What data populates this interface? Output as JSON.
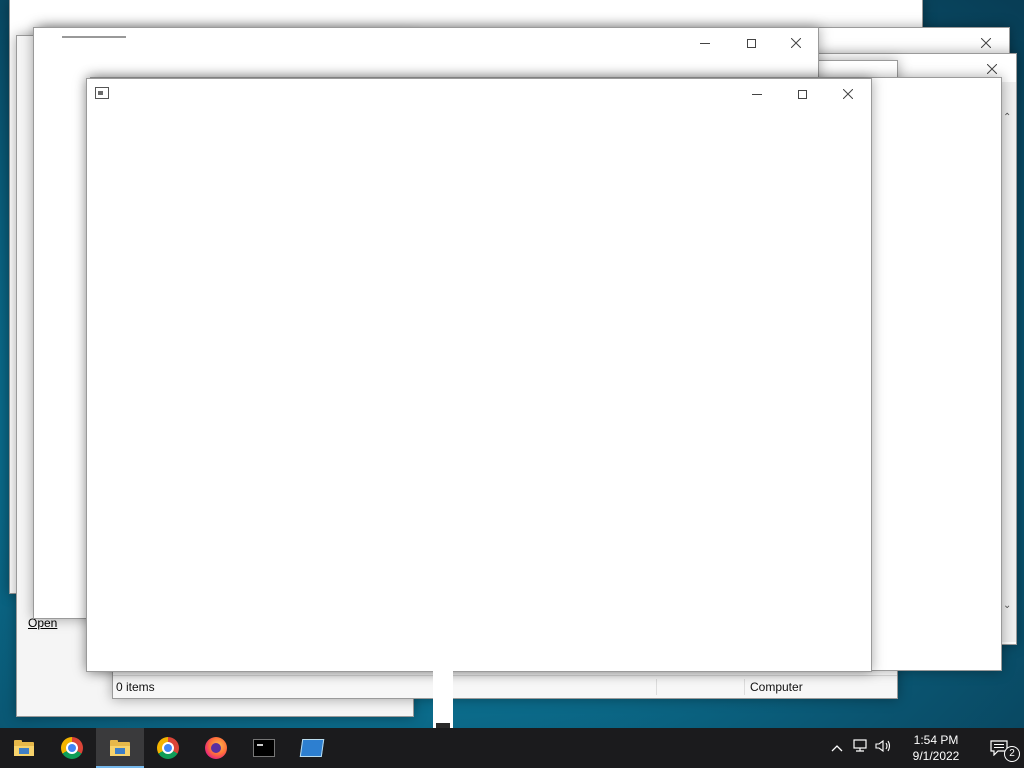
{
  "windows": {
    "back_window_status_left": "0 items",
    "back_window_status_right": "Computer",
    "open_label": "Open"
  },
  "taskbar": {
    "apps": [
      {
        "name": "File Explorer"
      },
      {
        "name": "Google Chrome"
      },
      {
        "name": "File Explorer (active)"
      },
      {
        "name": "Google Chrome"
      },
      {
        "name": "Firefox"
      },
      {
        "name": "Command Prompt"
      },
      {
        "name": "Remote Desktop"
      }
    ],
    "time": "1:54 PM",
    "date": "9/1/2022",
    "notification_count": "2"
  },
  "colors": {
    "taskbar_bg": "#1b1b1d",
    "desktop_accent": "#0e6d8c",
    "active_indicator": "#76b9ed"
  }
}
